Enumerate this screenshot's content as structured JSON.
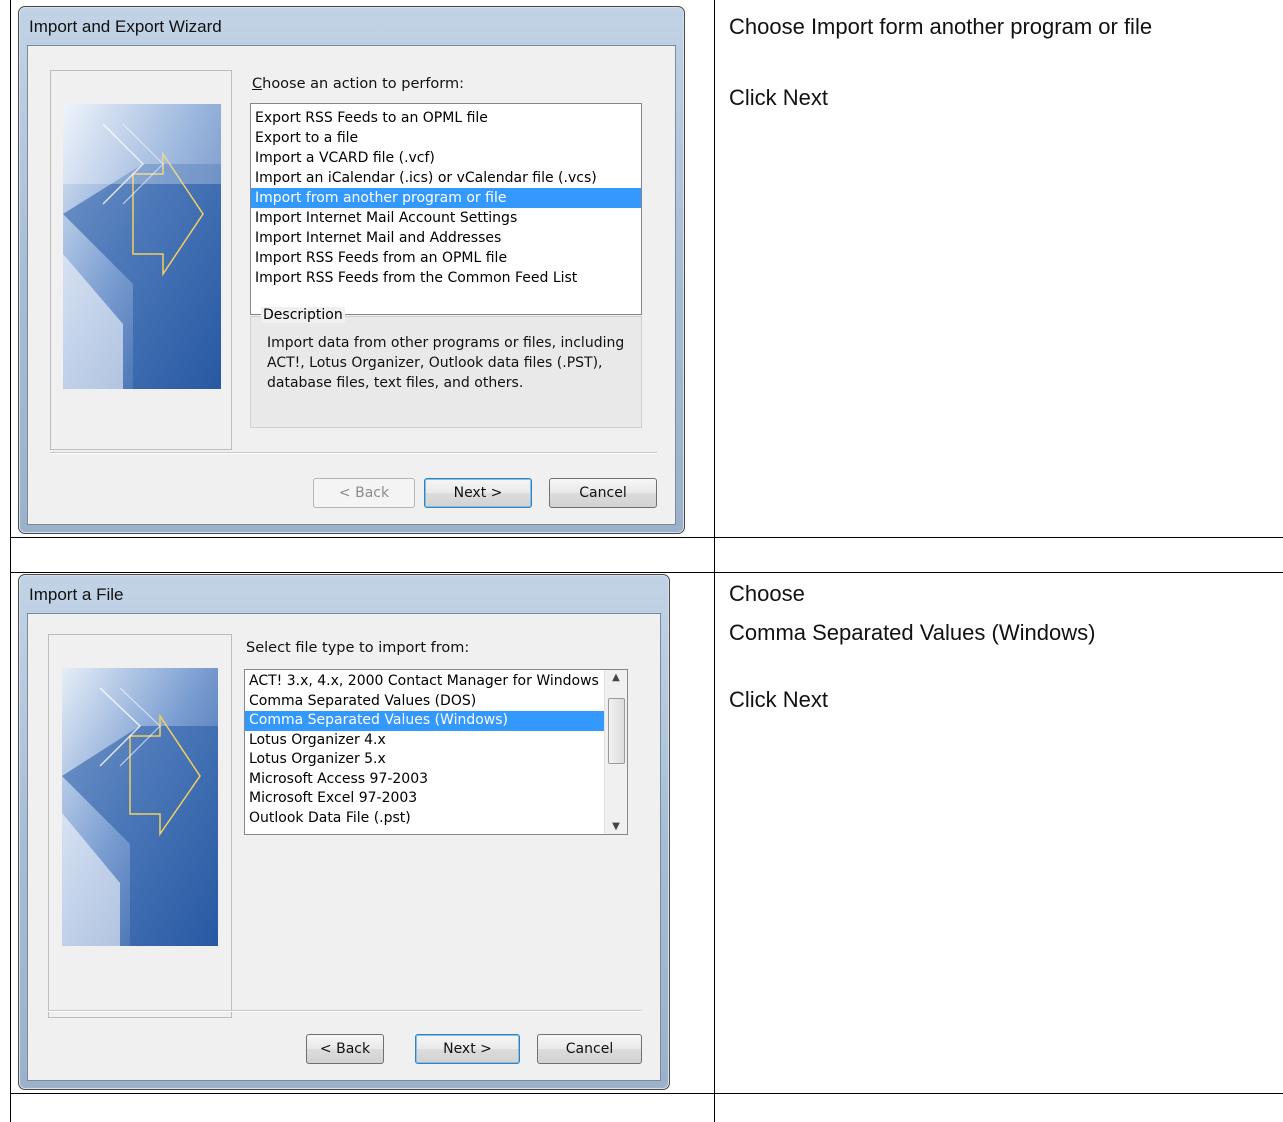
{
  "instructions": {
    "row1": [
      "Choose Import form another program or file",
      "Click Next"
    ],
    "row3": [
      "Choose",
      "Comma Separated Values (Windows)",
      "Click Next"
    ]
  },
  "dialog1": {
    "title": "Import and Export Wizard",
    "prompt": "Choose an action to perform:",
    "prompt_mnemonic": "C",
    "items": [
      "Export RSS Feeds to an OPML file",
      "Export to a file",
      "Import a VCARD file (.vcf)",
      "Import an iCalendar (.ics) or vCalendar file (.vcs)",
      "Import from another program or file",
      "Import Internet Mail Account Settings",
      "Import Internet Mail and Addresses",
      "Import RSS Feeds from an OPML file",
      "Import RSS Feeds from the Common Feed List"
    ],
    "selected_index": 4,
    "description_legend": "Description",
    "description": "Import data from other programs or files, including ACT!, Lotus Organizer, Outlook data files (.PST), database files, text files, and others.",
    "back_label": "< Back",
    "next_label": "Next >",
    "cancel_label": "Cancel"
  },
  "dialog2": {
    "title": "Import a File",
    "prompt": "Select file type to import from:",
    "items": [
      "ACT! 3.x, 4.x, 2000 Contact Manager for Windows",
      "Comma Separated Values (DOS)",
      "Comma Separated Values (Windows)",
      "Lotus Organizer 4.x",
      "Lotus Organizer 5.x",
      "Microsoft Access 97-2003",
      "Microsoft Excel 97-2003",
      "Outlook Data File (.pst)"
    ],
    "selected_index": 2,
    "back_label": "< Back",
    "next_label": "Next >",
    "cancel_label": "Cancel"
  },
  "colors": {
    "selection": "#3399ff",
    "frame": "#a6bcd4",
    "art_blue": "#2f5fa8"
  },
  "icons": [
    "scroll-up-icon",
    "scroll-down-icon",
    "wizard-arrow-art"
  ]
}
